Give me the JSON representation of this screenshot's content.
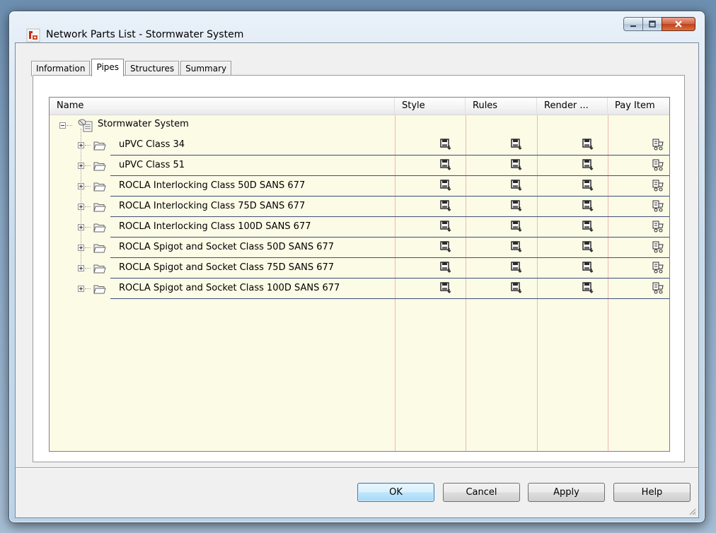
{
  "window": {
    "title": "Network Parts List - Stormwater System",
    "icon": "civil3d-app-icon"
  },
  "tabs": [
    {
      "label": "Information",
      "active": false
    },
    {
      "label": "Pipes",
      "active": true
    },
    {
      "label": "Structures",
      "active": false
    },
    {
      "label": "Summary",
      "active": false
    }
  ],
  "grid": {
    "columns": [
      "Name",
      "Style",
      "Rules",
      "Render ...",
      "Pay Item"
    ],
    "root": {
      "label": "Stormwater System",
      "icon": "network-tree-icon",
      "expanded": true
    },
    "rows": [
      {
        "label": "uPVC Class 34"
      },
      {
        "label": "uPVC Class 51"
      },
      {
        "label": "ROCLA Interlocking Class 50D SANS 677"
      },
      {
        "label": "ROCLA Interlocking Class 75D SANS 677"
      },
      {
        "label": "ROCLA Interlocking Class 100D SANS 677"
      },
      {
        "label": "ROCLA Spigot and Socket Class 50D SANS 677"
      },
      {
        "label": "ROCLA Spigot and Socket Class 75D SANS 677"
      },
      {
        "label": "ROCLA Spigot and Socket Class 100D SANS 677"
      }
    ],
    "cell_icons": {
      "style": "style-picker-icon",
      "rules": "rules-picker-icon",
      "render": "render-picker-icon",
      "pay_item": "pay-item-icon"
    }
  },
  "buttons": {
    "ok": "OK",
    "cancel": "Cancel",
    "apply": "Apply",
    "help": "Help"
  },
  "colors": {
    "grid_background": "#fcfbe6",
    "column_separator": "#f0b6b6",
    "row_underline": "#3b4f7a",
    "close_button": "#c1401c"
  }
}
